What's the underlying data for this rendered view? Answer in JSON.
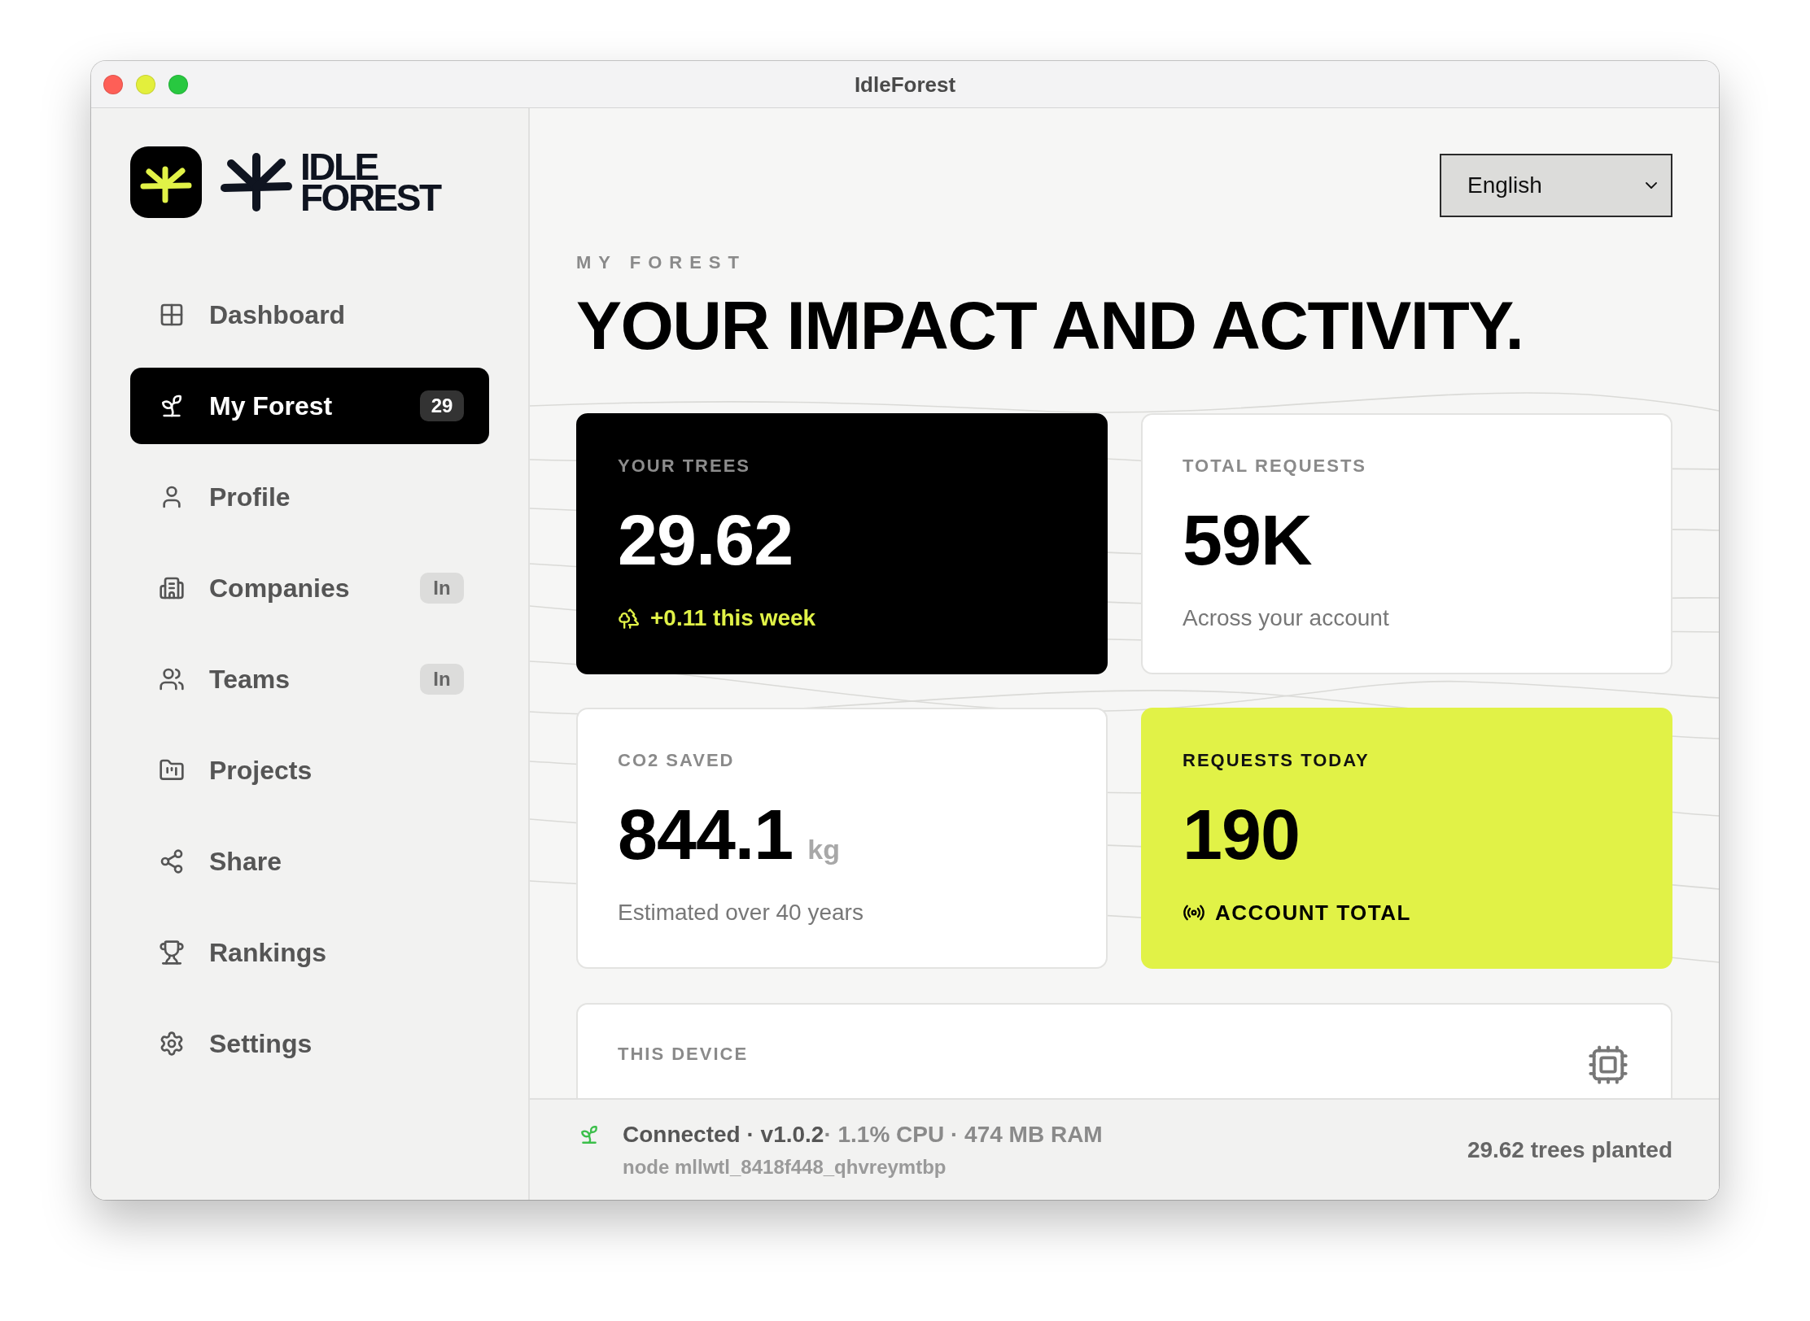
{
  "window": {
    "title": "IdleForest"
  },
  "sidebar": {
    "logo": {
      "wordmark": [
        "IDLE",
        "FOREST"
      ]
    },
    "items": [
      {
        "label": "Dashboard",
        "selected": false
      },
      {
        "label": "My Forest",
        "selected": true,
        "badge": "29"
      },
      {
        "label": "Profile",
        "selected": false
      },
      {
        "label": "Companies",
        "selected": false,
        "badge": "In"
      },
      {
        "label": "Teams",
        "selected": false,
        "badge": "In"
      },
      {
        "label": "Projects",
        "selected": false
      },
      {
        "label": "Share",
        "selected": false
      },
      {
        "label": "Rankings",
        "selected": false
      },
      {
        "label": "Settings",
        "selected": false
      }
    ]
  },
  "language_select": {
    "value": "English"
  },
  "header": {
    "eyebrow": "MY FOREST",
    "title": "YOUR IMPACT AND ACTIVITY."
  },
  "stats": [
    {
      "kind": "dark",
      "label": "YOUR TREES",
      "value": "29.62",
      "note": "+0.11 this week"
    },
    {
      "kind": "plain",
      "label": "TOTAL REQUESTS",
      "value": "59K",
      "note": "Across your account"
    },
    {
      "kind": "plain",
      "label": "CO2 SAVED",
      "value": "844.1",
      "unit": "kg",
      "note": "Estimated over 40 years"
    },
    {
      "kind": "accent",
      "label": "REQUESTS TODAY",
      "value": "190",
      "note": "ACCOUNT TOTAL"
    }
  ],
  "device_card": {
    "label": "THIS DEVICE"
  },
  "status_bar": {
    "status": "Connected · v1.0.2",
    "resources": "· 1.1% CPU · 474 MB RAM",
    "node": "node mllwtl_8418f448_qhvreymtbp",
    "trees_planted": "29.62 trees planted"
  }
}
